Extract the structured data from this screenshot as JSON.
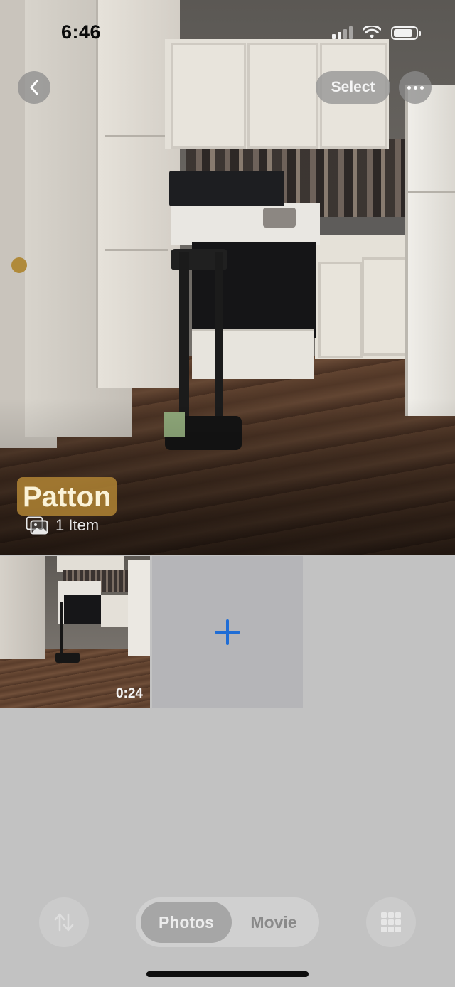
{
  "status_bar": {
    "time": "6:46",
    "icons": [
      "cellular-signal-icon",
      "wifi-icon",
      "battery-icon"
    ]
  },
  "nav": {
    "back_icon": "chevron-left-icon",
    "select_label": "Select",
    "more_icon": "ellipsis-icon"
  },
  "album": {
    "title": "Patton",
    "count_icon": "photo-stack-icon",
    "count_label": "1 Item"
  },
  "grid": {
    "items": [
      {
        "type": "video",
        "duration": "0:24"
      }
    ],
    "add_icon": "plus-icon"
  },
  "toolbar": {
    "sort_icon": "sort-arrows-icon",
    "segments": [
      {
        "label": "Photos",
        "selected": true
      },
      {
        "label": "Movie",
        "selected": false
      }
    ],
    "grid_icon": "grid-icon"
  },
  "colors": {
    "accent": "#1f6dd6",
    "title_highlight": "#b08434",
    "background": "#c2c2c2"
  }
}
